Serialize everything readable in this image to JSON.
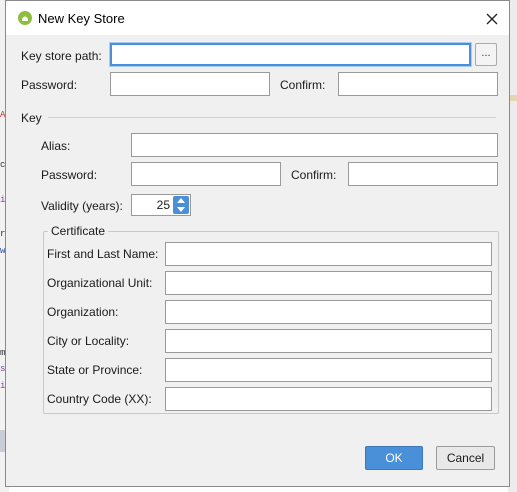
{
  "dialog": {
    "title": "New Key Store",
    "close_icon": "close-icon",
    "app_icon": "android-icon"
  },
  "keystore": {
    "path_label": "Key store path:",
    "path_value": "",
    "browse_label": "...",
    "password_label": "Password:",
    "password_value": "",
    "confirm_label": "Confirm:",
    "confirm_value": ""
  },
  "key": {
    "section_label": "Key",
    "alias_label": "Alias:",
    "alias_value": "",
    "password_label": "Password:",
    "password_value": "",
    "confirm_label": "Confirm:",
    "confirm_value": "",
    "validity_label": "Validity (years):",
    "validity_value": "25"
  },
  "certificate": {
    "legend": "Certificate",
    "first_last_label": "First and Last Name:",
    "org_unit_label": "Organizational Unit:",
    "organization_label": "Organization:",
    "city_label": "City or Locality:",
    "state_label": "State or Province:",
    "country_label": "Country Code (XX):"
  },
  "buttons": {
    "ok": "OK",
    "cancel": "Cancel"
  },
  "background_fragments": [
    {
      "text": "Ac",
      "color": "#c0392b"
    },
    {
      "text": "ca",
      "color": "#333333"
    },
    {
      "text": "iz",
      "color": "#7b3fa0"
    },
    {
      "text": "r",
      "color": "#333333"
    },
    {
      "text": "w",
      "color": "#2e4fa3"
    },
    {
      "text": "m",
      "color": "#333333"
    },
    {
      "text": "s",
      "color": "#7b3fa0"
    },
    {
      "text": "iz",
      "color": "#7b3fa0"
    }
  ],
  "colors": {
    "accent": "#4a90d9",
    "dialog_bg": "#f0f0f0",
    "app_icon": "#8cbf3f"
  }
}
